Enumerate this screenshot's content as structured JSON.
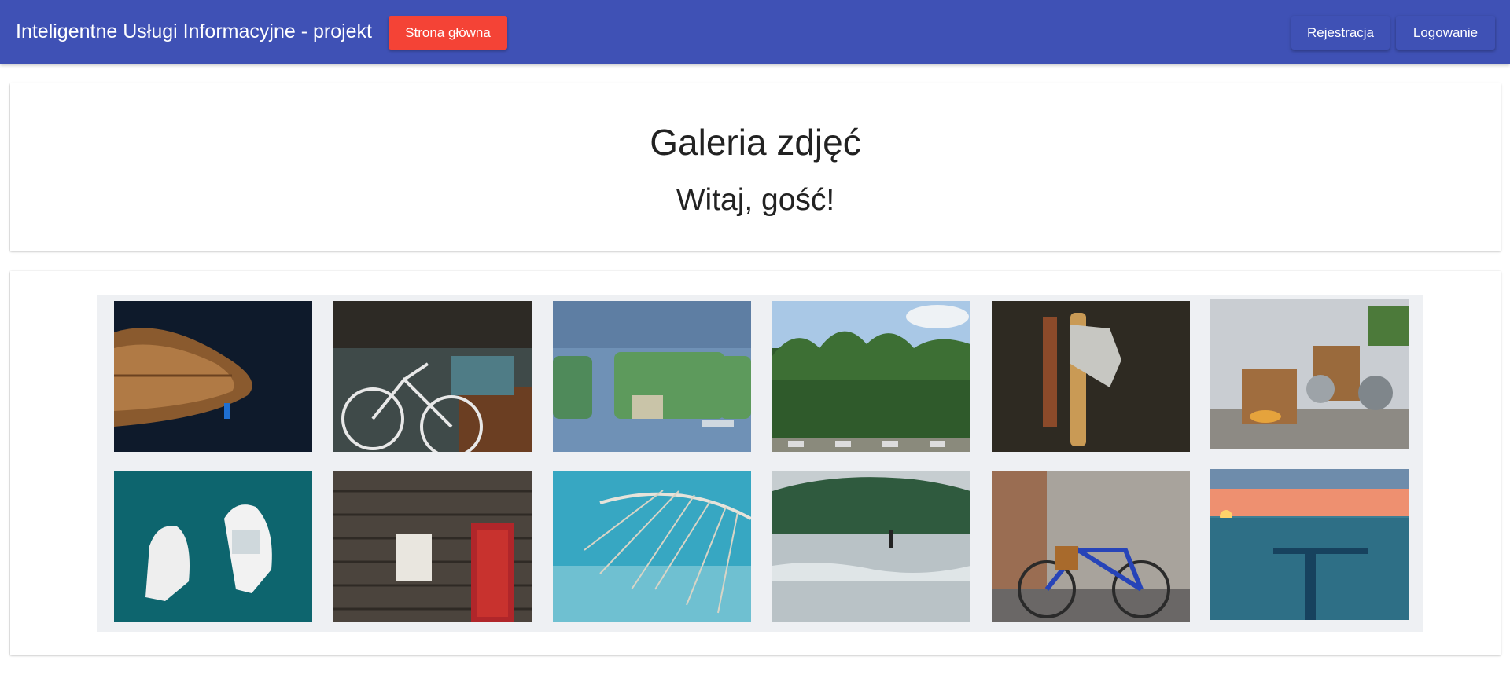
{
  "appbar": {
    "title": "Inteligentne Usługi Informacyjne - projekt",
    "home_label": "Strona główna",
    "register_label": "Rejestracja",
    "login_label": "Logowanie",
    "color": "#3f51b5",
    "home_color": "#f44336"
  },
  "header": {
    "title": "Galeria zdjęć",
    "greeting": "Witaj, gość!"
  },
  "gallery": {
    "photos": [
      "rowboat-photo",
      "bicycle-shop-photo",
      "bus-window-photo",
      "forest-photo",
      "knife-axe-photo",
      "pots-crates-photo",
      "motorboats-photo",
      "wooden-house-photo",
      "palm-leaf-photo",
      "surfer-photo",
      "blue-bicycle-photo",
      "pier-sunset-photo"
    ]
  }
}
